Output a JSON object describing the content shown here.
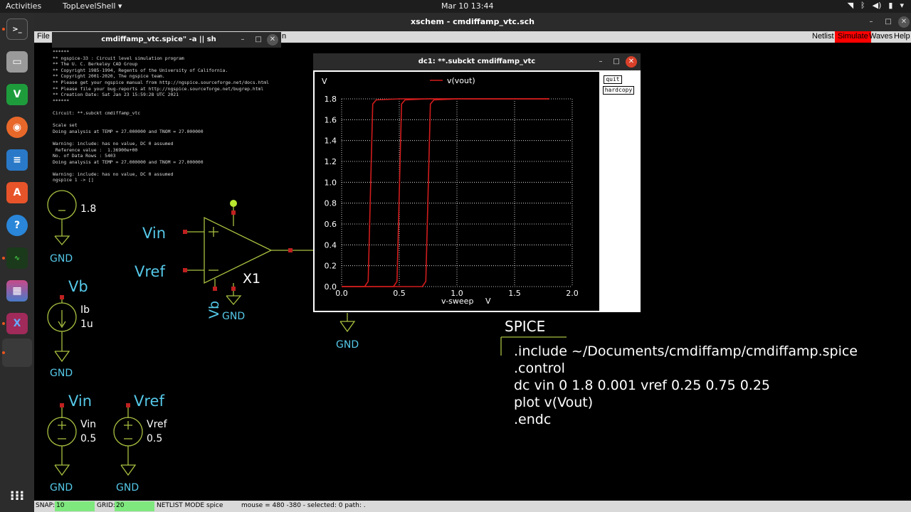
{
  "topbar": {
    "activities": "Activities",
    "app_menu": "TopLevelShell ▾",
    "clock": "Mar 10  13:44"
  },
  "xschem": {
    "window_title": "xschem - cmdiffamp_vtc.sch",
    "menu": {
      "file": "File",
      "hidden": "n"
    },
    "buttons": {
      "netlist": "Netlist",
      "simulate": "Simulate",
      "waves": "Waves",
      "help": "Help"
    },
    "colors": {
      "simulate_bg": "#ff0000",
      "wire_red": "#c02020",
      "cyan": "#55c8e8",
      "symbol_green": "#a8c040"
    }
  },
  "terminal": {
    "title": "cmdiffamp_vtc.spice\" -a || sh",
    "lines": [
      "******",
      "** ngspice-33 : Circuit level simulation program",
      "** The U. C. Berkeley CAD Group",
      "** Copyright 1985-1994, Regents of the University of California.",
      "** Copyright 2001-2020, The ngspice team.",
      "** Please get your ngspice manual from http://ngspice.sourceforge.net/docs.html",
      "** Please file your bug-reports at http://ngspice.sourceforge.net/bugrep.html",
      "** Creation Date: Sat Jan 23 15:59:28 UTC 2021",
      "******",
      "",
      "Circuit: **.subckt cmdiffamp_vtc",
      "",
      "Scale set",
      "Doing analysis at TEMP = 27.000000 and TNOM = 27.000000",
      "",
      "Warning: include: has no value, DC 0 assumed",
      " Reference value :  1.36900e+00",
      "No. of Data Rows : 5403",
      "Doing analysis at TEMP = 27.000000 and TNOM = 27.000000",
      "",
      "Warning: include: has no value, DC 0 assumed",
      "ngspice 1 -> []"
    ]
  },
  "schematic": {
    "vdd_value": "1.8",
    "vin_pin": "Vin",
    "vref_pin": "Vref",
    "vb_pin": "Vb",
    "amp_name": "X1",
    "vb_label": "Vb",
    "ib_name": "Ib",
    "ib_value": "1u",
    "vin_label": "Vin",
    "vref_label": "Vref",
    "vin_src_name": "Vin",
    "vin_src_value": "0.5",
    "vref_src_name": "Vref",
    "vref_src_value": "0.5",
    "gnd": "GND"
  },
  "plot": {
    "window_title": "dc1: **.subckt cmdiffamp_vtc",
    "quit": "quit",
    "hardcopy": "hardcopy"
  },
  "chart_data": {
    "type": "line",
    "title": "",
    "xlabel": "v-sweep",
    "xunit": "V",
    "yunit": "V",
    "xlim": [
      0.0,
      2.0
    ],
    "ylim": [
      0.0,
      1.8
    ],
    "x_ticks": [
      "0.0",
      "0.5",
      "1.0",
      "1.5",
      "2.0"
    ],
    "y_ticks": [
      "0.0",
      "0.2",
      "0.4",
      "0.6",
      "0.8",
      "1.0",
      "1.2",
      "1.4",
      "1.6",
      "1.8"
    ],
    "grid": true,
    "legend": "top",
    "series": [
      {
        "name": "v(vout)",
        "color": "#d01c1c",
        "x": [
          0.0,
          0.2,
          0.23,
          0.25,
          0.27,
          0.3,
          0.5,
          1.0,
          1.8
        ],
        "values": [
          0.0,
          0.0,
          0.05,
          0.9,
          1.75,
          1.79,
          1.8,
          1.8,
          1.8
        ]
      },
      {
        "name": "",
        "color": "#d01c1c",
        "x": [
          0.0,
          0.45,
          0.48,
          0.5,
          0.52,
          0.55,
          0.75,
          1.0,
          1.8
        ],
        "values": [
          0.0,
          0.0,
          0.05,
          0.9,
          1.75,
          1.79,
          1.8,
          1.8,
          1.8
        ]
      },
      {
        "name": "",
        "color": "#d01c1c",
        "x": [
          0.0,
          0.7,
          0.73,
          0.75,
          0.77,
          0.8,
          1.0,
          1.5,
          1.8
        ],
        "values": [
          0.0,
          0.0,
          0.05,
          0.9,
          1.75,
          1.79,
          1.8,
          1.8,
          1.8
        ]
      }
    ]
  },
  "spice_block": {
    "title": "SPICE",
    "lines": [
      ".include ~/Documents/cmdiffamp/cmdiffamp.spice",
      ".control",
      "dc vin 0 1.8 0.001 vref 0.25 0.75 0.25",
      "plot v(Vout)",
      ".endc"
    ]
  },
  "statusbar": {
    "snap_label": "SNAP:",
    "snap_value": "10",
    "grid_label": "GRID:",
    "grid_value": "20",
    "netlist_mode_label": "NETLIST MODE:",
    "netlist_mode_value": "spice",
    "mouse_info": "mouse = 480 -380 - selected: 0 path: ."
  }
}
